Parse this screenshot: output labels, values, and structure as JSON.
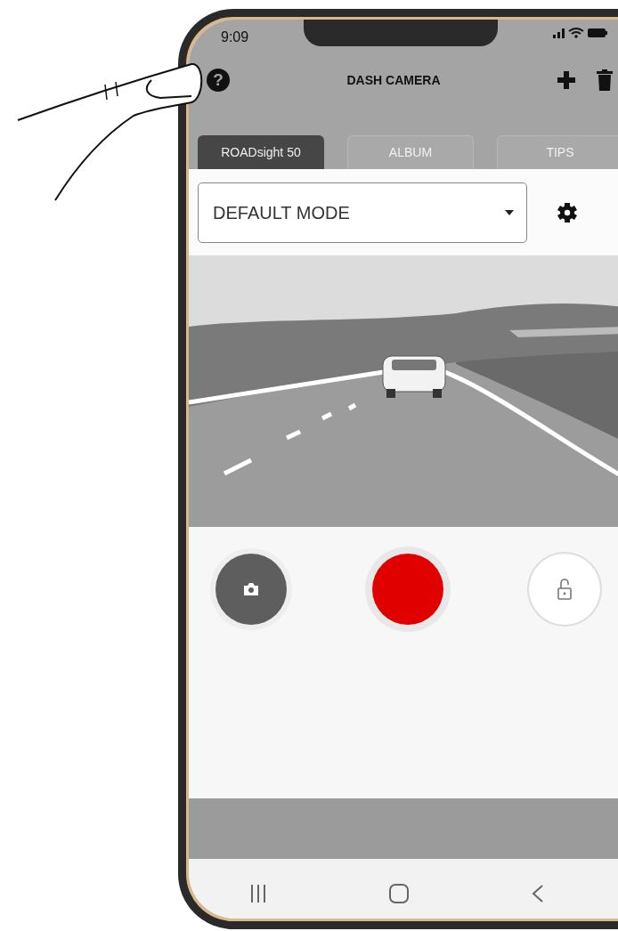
{
  "status_bar": {
    "time": "9:09"
  },
  "header": {
    "help": "?",
    "title": "DASH CAMERA"
  },
  "tabs": [
    {
      "label": "ROADsight 50",
      "selected": true
    },
    {
      "label": "ALBUM",
      "selected": false
    },
    {
      "label": "TIPS",
      "selected": false
    }
  ],
  "mode_select": {
    "value": "DEFAULT MODE"
  }
}
